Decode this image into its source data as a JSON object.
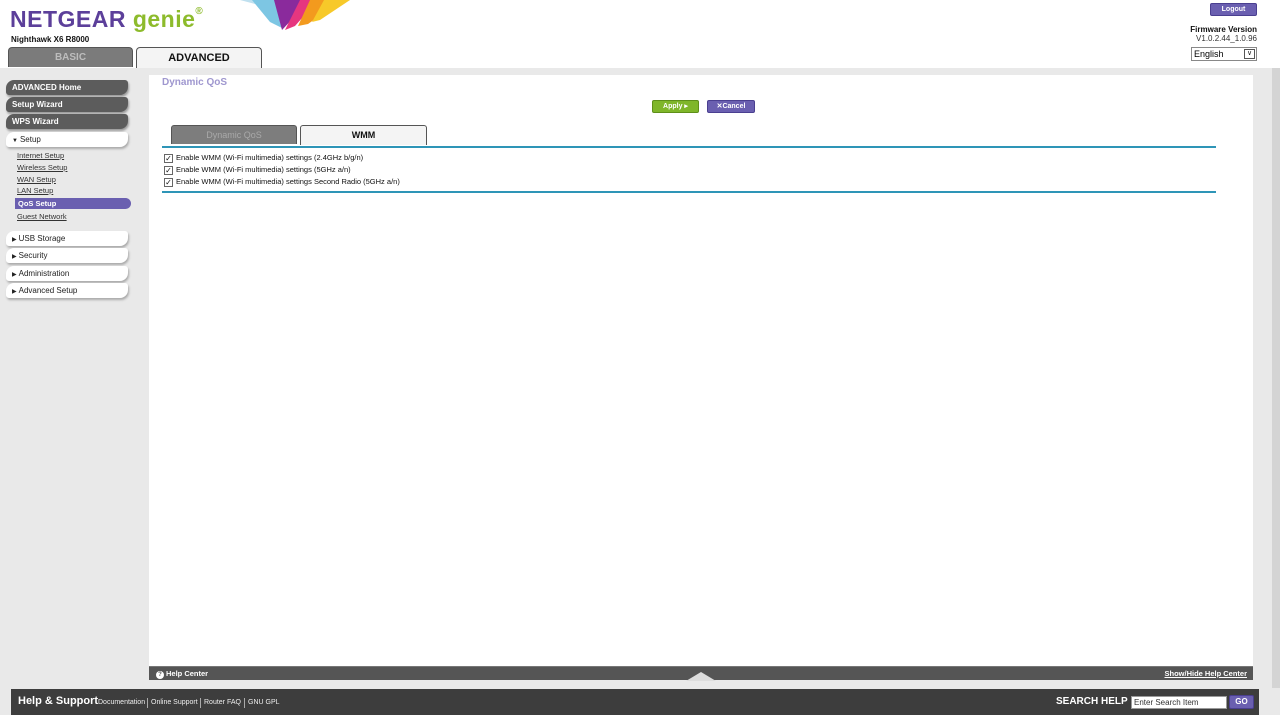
{
  "header": {
    "brand": "NETGEAR",
    "product": "genie",
    "model": "Nighthawk X6 R8000",
    "tabs": {
      "basic": "BASIC",
      "advanced": "ADVANCED"
    },
    "logout": "Logout",
    "firmware_label": "Firmware Version",
    "firmware_value": "V1.0.2.44_1.0.96",
    "language": "English"
  },
  "sidebar": {
    "advanced_home": "ADVANCED Home",
    "setup_wizard": "Setup Wizard",
    "wps_wizard": "WPS Wizard",
    "setup": "Setup",
    "setup_items": [
      "Internet Setup",
      "Wireless Setup",
      "WAN Setup",
      "LAN Setup",
      "QoS Setup",
      "Guest Network"
    ],
    "sections": [
      "USB Storage",
      "Security",
      "Administration",
      "Advanced Setup"
    ]
  },
  "main": {
    "title": "Dynamic QoS",
    "apply": "Apply ▸",
    "cancel": "Cancel",
    "tabs": {
      "dynamic_qos": "Dynamic QoS",
      "wmm": "WMM"
    },
    "options": [
      {
        "label": "Enable WMM (Wi-Fi multimedia) settings (2.4GHz b/g/n)",
        "checked": true
      },
      {
        "label": "Enable WMM (Wi-Fi multimedia) settings (5GHz a/n)",
        "checked": true
      },
      {
        "label": "Enable WMM (Wi-Fi multimedia) settings Second Radio (5GHz a/n)",
        "checked": true
      }
    ]
  },
  "help_bar": {
    "help_center": "Help Center",
    "show_hide": "Show/Hide Help Center"
  },
  "footer": {
    "title": "Help & Support",
    "links": [
      "Documentation",
      "Online Support",
      "Router FAQ",
      "GNU GPL"
    ],
    "search_label": "SEARCH HELP",
    "search_placeholder": "Enter Search Item",
    "go": "GO"
  },
  "colors": {
    "accent_purple": "#6a5fb0",
    "accent_green": "#7fb62a",
    "rule_blue": "#2e95b7",
    "title_lavender": "#9f97cf"
  }
}
